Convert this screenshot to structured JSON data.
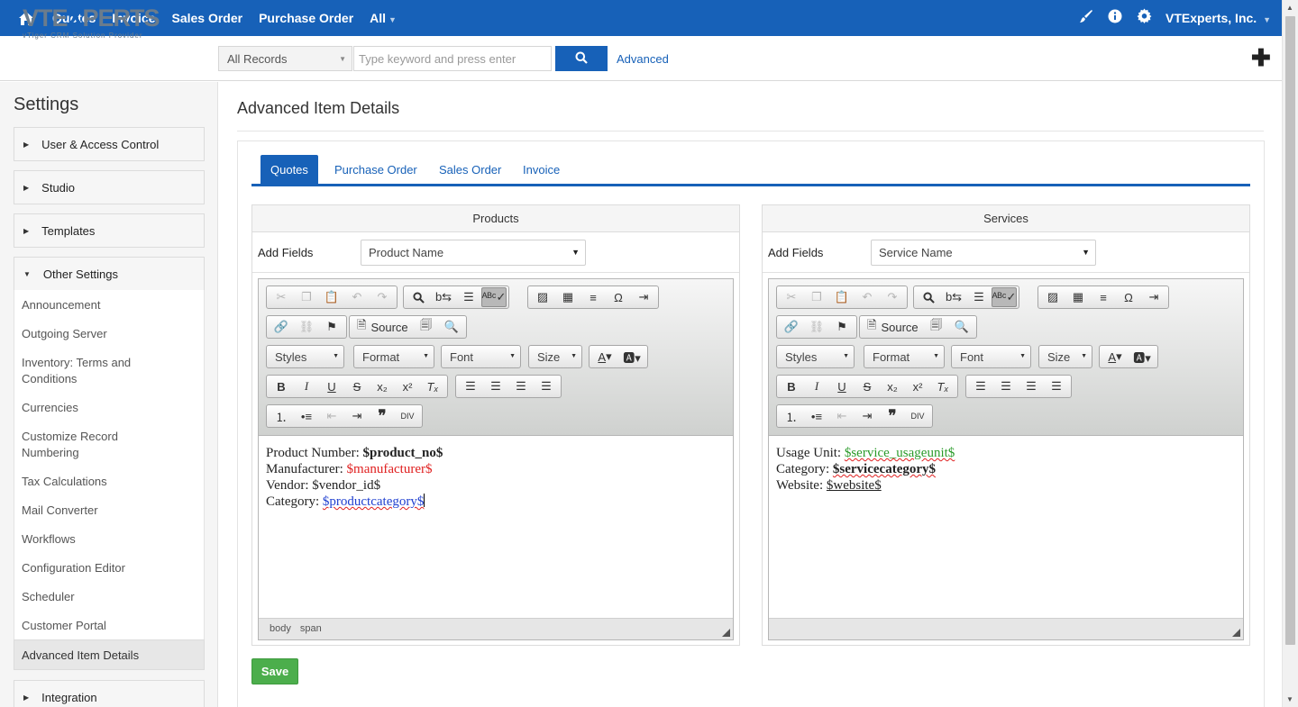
{
  "topnav": {
    "items": [
      "Quotes",
      "Invoice",
      "Sales Order",
      "Purchase Order",
      "All"
    ],
    "company": "VTExperts, Inc.",
    "icons": [
      "home-icon",
      "brush-icon",
      "info-icon",
      "gear-icon"
    ]
  },
  "logo": {
    "main_left": "VTE",
    "main_x": "X",
    "main_right": "PERTS",
    "tagline": "vTiger CRM Solution Provider"
  },
  "search": {
    "record_filter": "All Records",
    "placeholder": "Type keyword and press enter",
    "advanced_label": "Advanced"
  },
  "sidebar": {
    "title": "Settings",
    "sections": [
      "User & Access Control",
      "Studio",
      "Templates",
      "Other Settings",
      "Integration"
    ],
    "other_settings_items": [
      "Announcement",
      "Outgoing Server",
      "Inventory: Terms and Conditions",
      "Currencies",
      "Customize Record Numbering",
      "Tax Calculations",
      "Mail Converter",
      "Workflows",
      "Configuration Editor",
      "Scheduler",
      "Customer Portal"
    ],
    "active_item": "Advanced Item Details"
  },
  "main": {
    "title": "Advanced Item Details",
    "tabs": [
      "Quotes",
      "Purchase Order",
      "Sales Order",
      "Invoice"
    ],
    "active_tab": "Quotes",
    "save_label": "Save"
  },
  "products": {
    "header": "Products",
    "add_fields_label": "Add Fields",
    "selected_field": "Product Name",
    "lines": [
      {
        "label": "Product Number: ",
        "value": "$product_no$"
      },
      {
        "label": "Manufacturer: ",
        "value": "$manufacturer$"
      },
      {
        "label": "Vendor: ",
        "value": "$vendor_id$"
      },
      {
        "label": "Category: ",
        "value": "$productcategory$"
      }
    ],
    "path": [
      "body",
      "span"
    ]
  },
  "services": {
    "header": "Services",
    "add_fields_label": "Add Fields",
    "selected_field": "Service Name",
    "lines": [
      {
        "label": "Usage Unit: ",
        "value": "$service_usageunit$"
      },
      {
        "label": "Category: ",
        "value": "$servicecategory$"
      },
      {
        "label": "Website: ",
        "value": "$website$"
      }
    ]
  },
  "editor_toolbar": {
    "source_label": "Source",
    "styles_label": "Styles",
    "format_label": "Format",
    "font_label": "Font",
    "size_label": "Size"
  },
  "colors": {
    "brand": "#1761b8",
    "save": "#4cae4c",
    "manufacturer": "#e02020",
    "service_value": "#2a9b2a",
    "category_link": "#1f3fd0"
  }
}
